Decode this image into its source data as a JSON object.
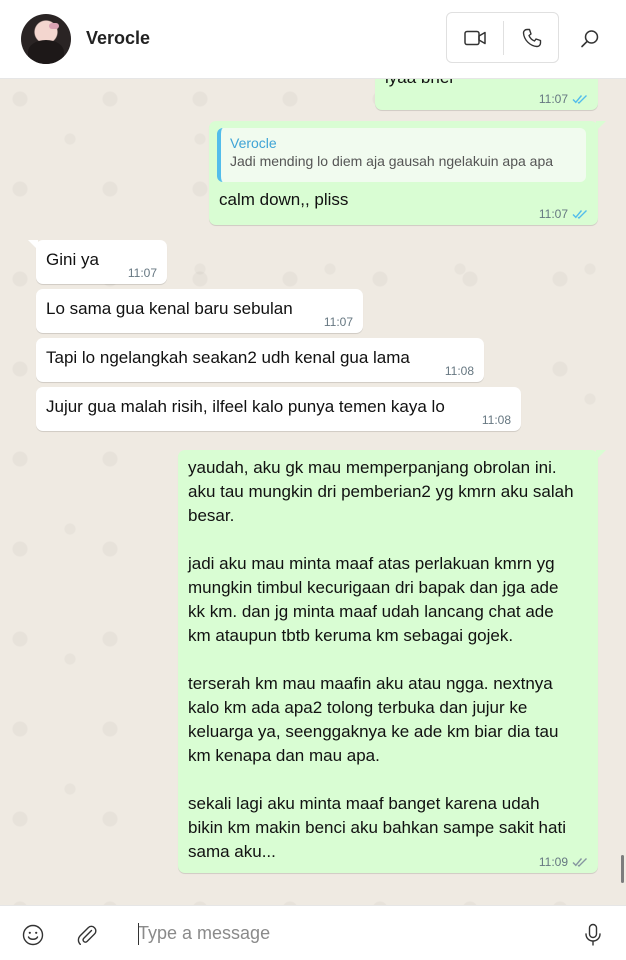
{
  "header": {
    "contact_name": "Verocle"
  },
  "messages": [
    {
      "dir": "out",
      "text": "iyaa bner",
      "time": "11:07",
      "status": "read"
    },
    {
      "dir": "out",
      "quote": {
        "author": "Verocle",
        "text": "Jadi mending lo diem aja gausah ngelakuin apa apa"
      },
      "text": "calm down,, pliss",
      "time": "11:07",
      "status": "read"
    },
    {
      "dir": "in",
      "text": "Gini ya",
      "time": "11:07"
    },
    {
      "dir": "in",
      "text": "Lo sama gua kenal baru sebulan",
      "time": "11:07"
    },
    {
      "dir": "in",
      "text": "Tapi lo ngelangkah seakan2 udh kenal gua lama",
      "time": "11:08"
    },
    {
      "dir": "in",
      "text": "Jujur gua malah risih, ilfeel kalo punya temen kaya lo",
      "time": "11:08"
    },
    {
      "dir": "out",
      "text": "yaudah, aku gk mau memperpanjang obrolan ini. aku tau mungkin dri pemberian2 yg kmrn aku salah besar.\n\njadi aku mau minta maaf atas perlakuan kmrn yg mungkin timbul kecurigaan dri bapak dan jga ade kk km. dan jg minta maaf udah lancang chat ade km ataupun tbtb keruma km sebagai gojek.\n\nterserah km mau maafin aku atau ngga. nextnya kalo km ada apa2 tolong terbuka dan jujur ke keluarga ya, seenggaknya ke ade km biar dia tau km kenapa dan mau apa.\n\nsekali lagi aku minta maaf banget karena udah bikin km makin benci aku bahkan sampe sakit hati sama aku...",
      "time": "11:09",
      "status": "delivered"
    }
  ],
  "composer": {
    "placeholder": "Type a message"
  },
  "colors": {
    "outgoing_bubble": "#d9fdd3",
    "incoming_bubble": "#ffffff",
    "read_tick": "#53bdeb",
    "quote_bar": "#53bdeb"
  },
  "icons": {
    "video_call": "video-camera-icon",
    "voice_call": "phone-icon",
    "search": "search-icon",
    "emoji": "smiley-icon",
    "attach": "paperclip-icon",
    "mic": "microphone-icon",
    "read": "double-check-icon"
  }
}
